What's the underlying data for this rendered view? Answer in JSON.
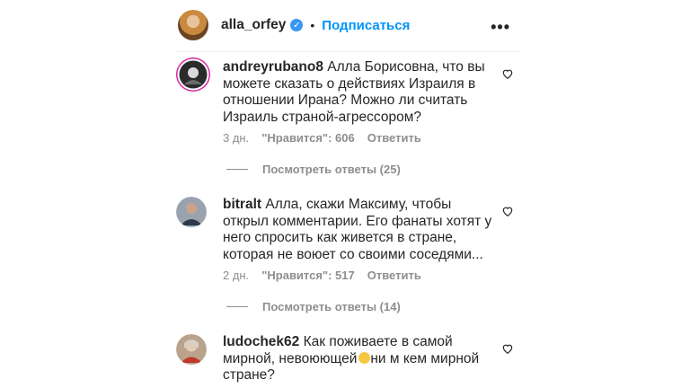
{
  "header": {
    "username": "alla_orfey",
    "verified_icon": "verified-badge-icon",
    "separator": "•",
    "follow_label": "Подписаться",
    "more_icon": "more-options-icon",
    "more_glyph": "•••"
  },
  "comments": [
    {
      "username": "andreyrubano8",
      "text": "Алла Борисовна, что вы можете сказать о действиях Израиля в отношении Ирана? Можно ли считать Израиль страной-агрессором?",
      "age": "3 дн.",
      "likes": "\"Нравится\": 606",
      "reply_label": "Ответить",
      "view_replies": "Посмотреть ответы (25)"
    },
    {
      "username": "bitralt",
      "text": "Алла, скажи Максиму, чтобы открыл комментарии. Его фанаты хотят у него спросить как живется в стране, которая не воюет со своими соседями...",
      "age": "2 дн.",
      "likes": "\"Нравится\": 517",
      "reply_label": "Ответить",
      "view_replies": "Посмотреть ответы (14)"
    },
    {
      "username": "ludochek62",
      "text_before": "Как поживаете в самой мирной, невоюющей",
      "text_after": "ни м кем мирной стране?"
    }
  ],
  "colors": {
    "text": "#262626",
    "secondary": "#8e8e8e",
    "link": "#0095f6",
    "verified": "#3897f0"
  }
}
